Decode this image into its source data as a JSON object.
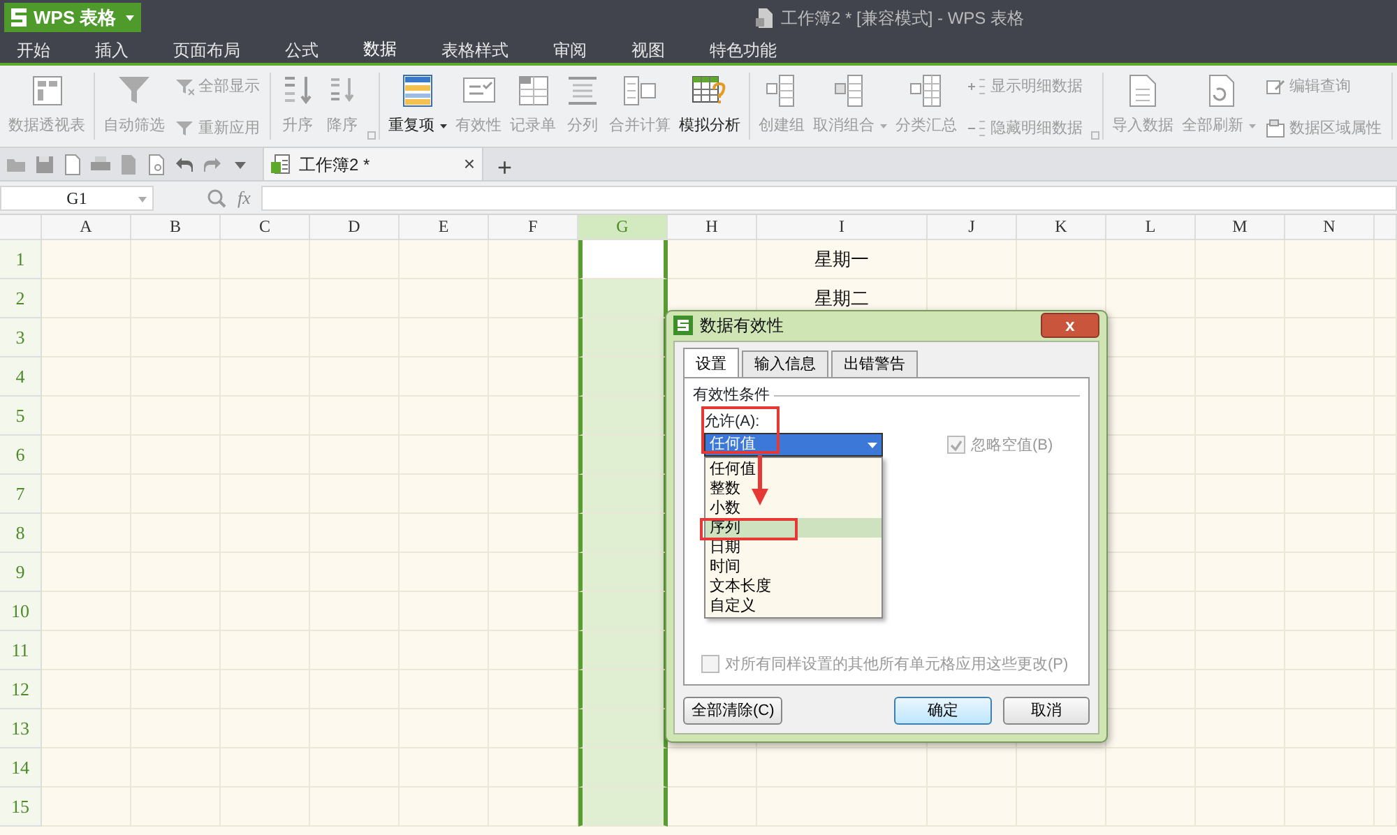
{
  "app_button": {
    "label": "WPS 表格"
  },
  "window": {
    "title": "工作簿2 * [兼容模式] - WPS 表格"
  },
  "menu_tabs": [
    {
      "label": "开始",
      "selected": false
    },
    {
      "label": "插入",
      "selected": false
    },
    {
      "label": "页面布局",
      "selected": false
    },
    {
      "label": "公式",
      "selected": false
    },
    {
      "label": "数据",
      "selected": true
    },
    {
      "label": "表格样式",
      "selected": false
    },
    {
      "label": "审阅",
      "selected": false
    },
    {
      "label": "视图",
      "selected": false
    },
    {
      "label": "特色功能",
      "selected": false
    }
  ],
  "ribbon": {
    "groups": [
      {
        "launcher": false,
        "items": [
          {
            "label": "数据透视表",
            "kind": "large",
            "disabled": true,
            "dropdown": false
          }
        ]
      },
      {
        "launcher": false,
        "items": [
          {
            "label": "自动筛选",
            "kind": "large",
            "disabled": true,
            "dropdown": false
          },
          {
            "label": "全部显示",
            "kind": "small",
            "disabled": true,
            "dropdown": false
          },
          {
            "label": "重新应用",
            "kind": "small",
            "disabled": true,
            "dropdown": false
          }
        ]
      },
      {
        "launcher": true,
        "items": [
          {
            "label": "升序",
            "kind": "large",
            "disabled": true,
            "dropdown": false
          },
          {
            "label": "降序",
            "kind": "large",
            "disabled": true,
            "dropdown": false
          }
        ]
      },
      {
        "launcher": false,
        "items": [
          {
            "label": "重复项",
            "kind": "large",
            "disabled": false,
            "dropdown": true
          },
          {
            "label": "有效性",
            "kind": "large",
            "disabled": true,
            "dropdown": false
          },
          {
            "label": "记录单",
            "kind": "large",
            "disabled": true,
            "dropdown": false
          },
          {
            "label": "分列",
            "kind": "large",
            "disabled": true,
            "dropdown": false
          },
          {
            "label": "合并计算",
            "kind": "large",
            "disabled": true,
            "dropdown": false
          },
          {
            "label": "模拟分析",
            "kind": "large",
            "disabled": false,
            "dropdown": false
          }
        ]
      },
      {
        "launcher": true,
        "items": [
          {
            "label": "创建组",
            "kind": "large",
            "disabled": true,
            "dropdown": false
          },
          {
            "label": "取消组合",
            "kind": "large",
            "disabled": true,
            "dropdown": true
          },
          {
            "label": "分类汇总",
            "kind": "large",
            "disabled": true,
            "dropdown": false
          },
          {
            "label": "显示明细数据",
            "kind": "small",
            "disabled": true,
            "dropdown": false
          },
          {
            "label": "隐藏明细数据",
            "kind": "small",
            "disabled": true,
            "dropdown": false
          }
        ]
      },
      {
        "launcher": false,
        "items": [
          {
            "label": "导入数据",
            "kind": "large",
            "disabled": true,
            "dropdown": false
          },
          {
            "label": "全部刷新",
            "kind": "large",
            "disabled": true,
            "dropdown": true
          },
          {
            "label": "编辑查询",
            "kind": "small",
            "disabled": true,
            "dropdown": false
          },
          {
            "label": "数据区域属性",
            "kind": "small",
            "disabled": true,
            "dropdown": false
          }
        ]
      }
    ]
  },
  "doc_tabs": [
    {
      "label": "工作簿2 *",
      "selected": true,
      "close": "×"
    }
  ],
  "new_tab": "+",
  "formula_bar": {
    "name_box": "G1",
    "fx": "fx"
  },
  "sheet": {
    "columns": [
      {
        "label": "A",
        "selected": false
      },
      {
        "label": "B",
        "selected": false
      },
      {
        "label": "C",
        "selected": false
      },
      {
        "label": "D",
        "selected": false
      },
      {
        "label": "E",
        "selected": false
      },
      {
        "label": "F",
        "selected": false
      },
      {
        "label": "G",
        "selected": true
      },
      {
        "label": "H",
        "selected": false
      },
      {
        "label": "I",
        "selected": false,
        "cells": [
          "星期一",
          "星期二"
        ]
      },
      {
        "label": "J",
        "selected": false
      },
      {
        "label": "K",
        "selected": false
      },
      {
        "label": "L",
        "selected": false
      },
      {
        "label": "M",
        "selected": false
      },
      {
        "label": "N",
        "selected": false
      }
    ],
    "rows": [
      "1",
      "2",
      "3",
      "4",
      "5",
      "6",
      "7",
      "8",
      "9",
      "10",
      "11",
      "12",
      "13",
      "14",
      "15"
    ]
  },
  "dialog": {
    "title": "数据有效性",
    "close": "x",
    "tabs": [
      {
        "label": "设置",
        "selected": true
      },
      {
        "label": "输入信息",
        "selected": false
      },
      {
        "label": "出错警告",
        "selected": false
      }
    ],
    "group_label": "有效性条件",
    "allow_label": "允许(A):",
    "allow_value": "任何值",
    "options": [
      {
        "label": "任何值",
        "selected": false
      },
      {
        "label": "整数",
        "selected": false
      },
      {
        "label": "小数",
        "selected": false
      },
      {
        "label": "序列",
        "selected": true
      },
      {
        "label": "日期",
        "selected": false
      },
      {
        "label": "时间",
        "selected": false
      },
      {
        "label": "文本长度",
        "selected": false
      },
      {
        "label": "自定义",
        "selected": false
      }
    ],
    "ignore_blank": {
      "label": "忽略空值(B)",
      "checked": true,
      "disabled": true
    },
    "apply_all": {
      "label": "对所有同样设置的其他所有单元格应用这些更改(P)",
      "checked": false,
      "disabled": true
    },
    "buttons": [
      {
        "label": "全部清除(C)",
        "kind": "left"
      },
      {
        "label": "确定",
        "kind": "default"
      },
      {
        "label": "取消",
        "kind": "normal"
      }
    ]
  }
}
